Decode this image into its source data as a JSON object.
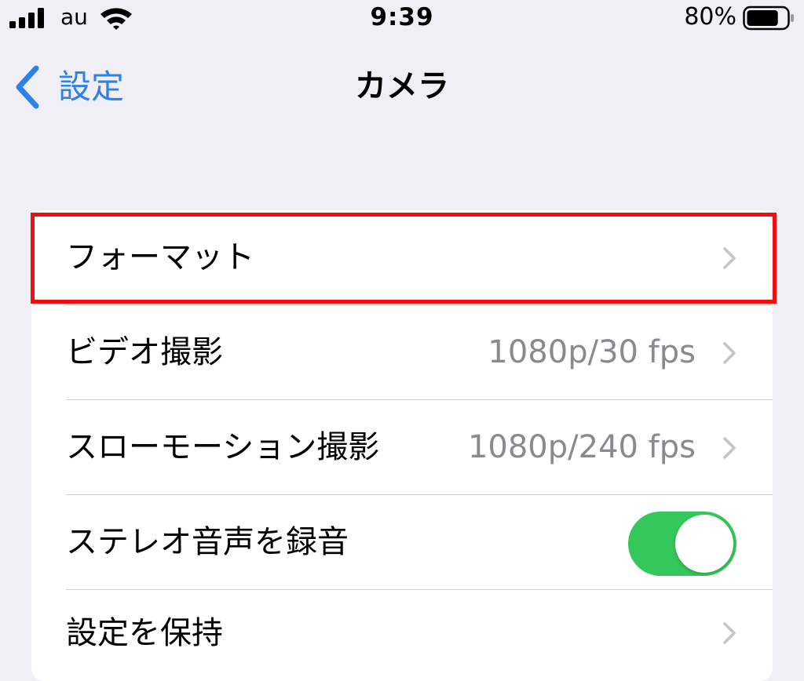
{
  "status_bar": {
    "carrier": "au",
    "time": "9:39",
    "battery_percent": "80%",
    "battery_level": 0.8,
    "signal_bars": 4,
    "icons": [
      "signal-icon",
      "wifi-icon",
      "battery-icon"
    ]
  },
  "nav": {
    "back_label": "設定",
    "title": "カメラ",
    "accent_color": "#2f80ed"
  },
  "rows": [
    {
      "label": "フォーマット",
      "value": "",
      "type": "disclosure"
    },
    {
      "label": "ビデオ撮影",
      "value": "1080p/30 fps",
      "type": "disclosure"
    },
    {
      "label": "スローモーション撮影",
      "value": "1080p/240 fps",
      "type": "disclosure"
    },
    {
      "label": "ステレオ音声を録音",
      "value": "",
      "type": "toggle",
      "on": true,
      "toggle_color": "#34c759"
    },
    {
      "label": "設定を保持",
      "value": "",
      "type": "disclosure"
    }
  ],
  "highlight": {
    "color": "#ee1010",
    "row": "フォーマット"
  }
}
